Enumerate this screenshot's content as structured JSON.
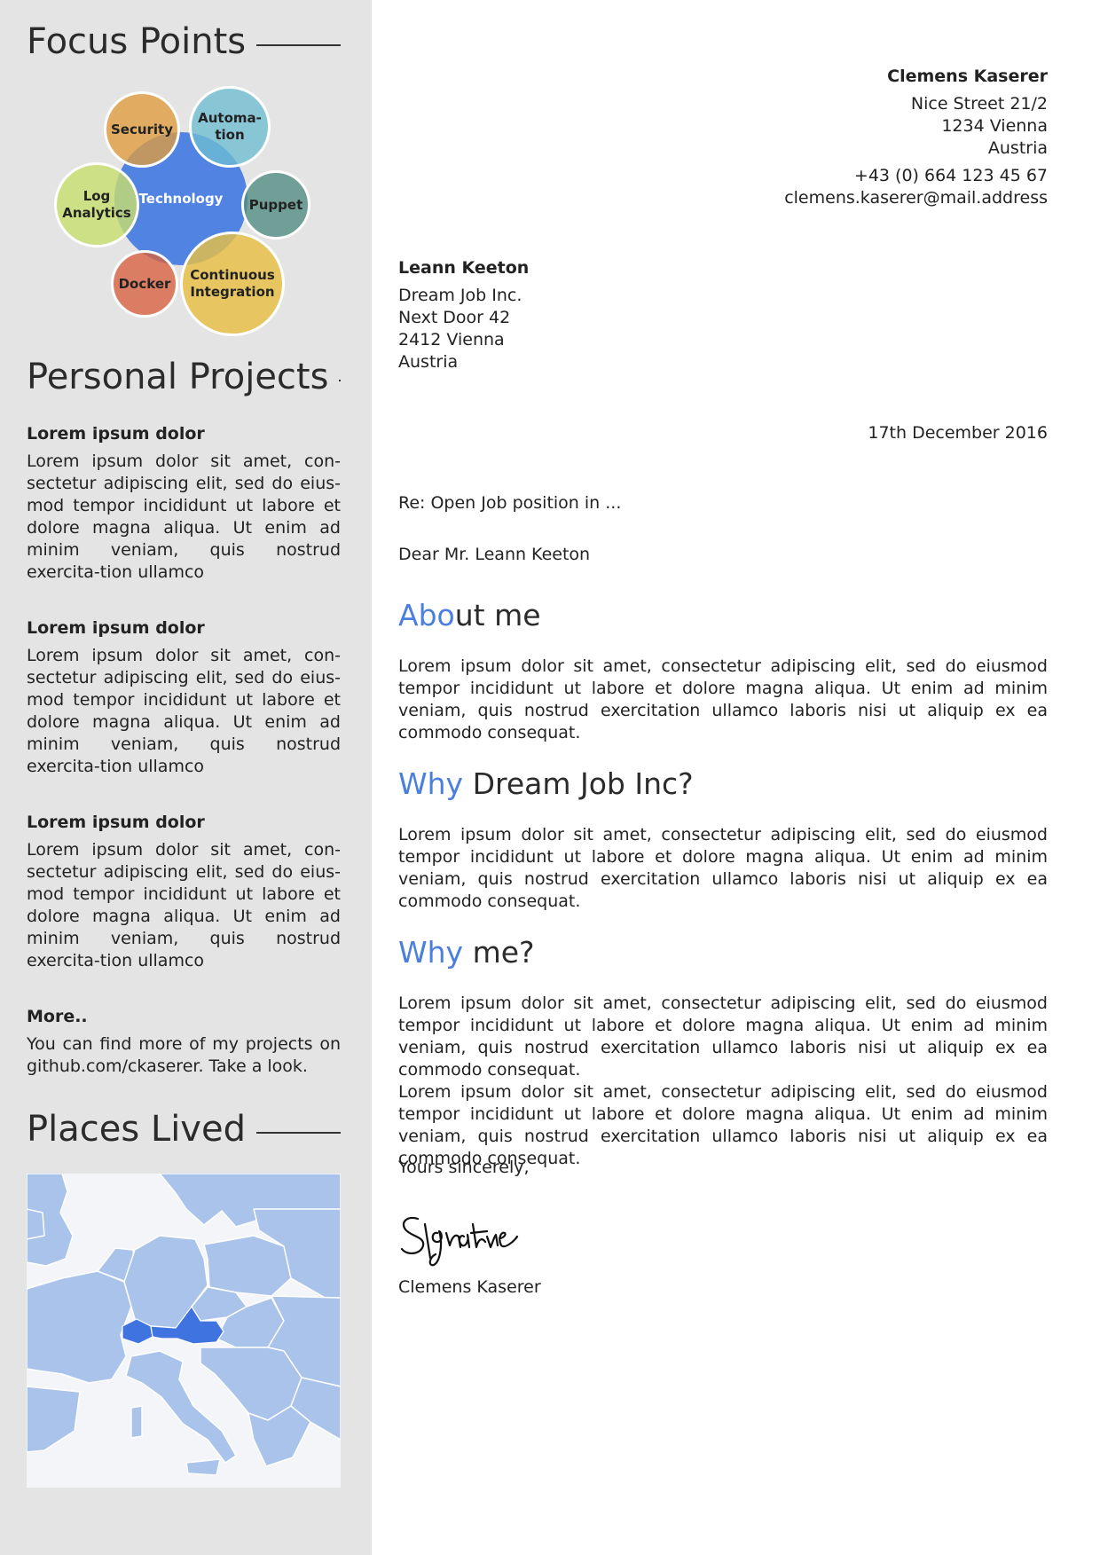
{
  "sidebar": {
    "focus_title": "Focus Points",
    "focus_items": {
      "center": "Technology",
      "security": "Security",
      "automation": "Automa-\ntion",
      "puppet": "Puppet",
      "ci": "Continuous\nIntegration",
      "docker": "Docker",
      "log": "Log\nAnalytics"
    },
    "projects_title": "Personal Projects",
    "projects": [
      {
        "title": "Lorem ipsum dolor",
        "body": "Lorem ipsum dolor sit amet, con-sectetur adipiscing elit, sed do eius-mod tempor incididunt ut labore et dolore magna aliqua.  Ut enim ad minim veniam, quis nostrud exercita-tion ullamco"
      },
      {
        "title": "Lorem ipsum dolor",
        "body": "Lorem ipsum dolor sit amet, con-sectetur adipiscing elit, sed do eius-mod tempor incididunt ut labore et dolore magna aliqua.  Ut enim ad minim veniam, quis nostrud exercita-tion ullamco"
      },
      {
        "title": "Lorem ipsum dolor",
        "body": "Lorem ipsum dolor sit amet, con-sectetur adipiscing elit, sed do eius-mod tempor incididunt ut labore et dolore magna aliqua.  Ut enim ad minim veniam, quis nostrud exercita-tion ullamco"
      }
    ],
    "more_title": "More..",
    "more_body": "You can find more of my projects on github.com/ckaserer. Take a look.",
    "places_title": "Places Lived",
    "colors": {
      "sidebar_bg": "#e4e4e4",
      "map_land": "#a9c3ea",
      "map_highlight": "#3f74e0",
      "accent": "#4a7fe0"
    }
  },
  "sender": {
    "name": "Clemens Kaserer",
    "street": "Nice Street 21/2",
    "city": "1234 Vienna",
    "country": "Austria",
    "phone": "+43 (0) 664 123 45 67",
    "email": "clemens.kaserer@mail.address"
  },
  "recipient": {
    "name": "Leann Keeton",
    "company": "Dream Job Inc.",
    "street": "Next Door 42",
    "city": "2412 Vienna",
    "country": "Austria"
  },
  "letter": {
    "date": "17th December 2016",
    "subject": "Re: Open Job position in ...",
    "salutation": "Dear Mr. Leann Keeton",
    "sections": [
      {
        "accent": "Abo",
        "rest": "ut me",
        "body": "Lorem ipsum dolor sit amet, consectetur adipiscing elit, sed do eiusmod tempor incididunt ut labore et dolore magna aliqua.  Ut enim ad minim veniam, quis nostrud exercitation ullamco laboris nisi ut aliquip ex ea commodo consequat."
      },
      {
        "accent": "Why",
        "rest": " Dream Job Inc?",
        "body": "Lorem ipsum dolor sit amet, consectetur adipiscing elit, sed do eiusmod tempor incididunt ut labore et dolore magna aliqua.  Ut enim ad minim veniam, quis nostrud exercitation ullamco laboris nisi ut aliquip ex ea commodo consequat."
      },
      {
        "accent": "Why",
        "rest": " me?",
        "body": "Lorem ipsum dolor sit amet, consectetur adipiscing elit, sed do eiusmod tempor incididunt ut labore et dolore magna aliqua.  Ut enim ad minim veniam, quis nostrud exercitation ullamco laboris nisi ut aliquip ex ea commodo consequat."
      }
    ],
    "extra_para": "Lorem ipsum dolor sit amet, consectetur adipiscing elit, sed do eiusmod tempor incididunt ut labore et dolore magna aliqua.  Ut enim ad minim veniam, quis nostrud exercitation ullamco laboris nisi ut aliquip ex ea commodo consequat.",
    "closing": "Yours sincerely,",
    "signature_text": "Signature",
    "signed_name": "Clemens Kaserer"
  }
}
